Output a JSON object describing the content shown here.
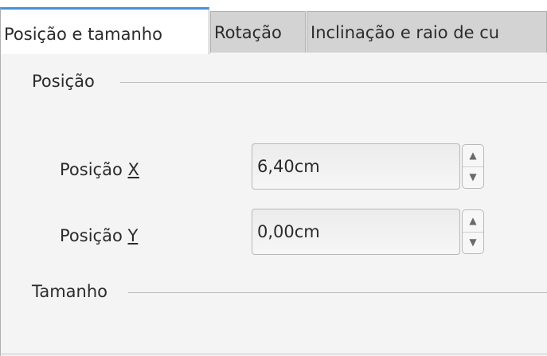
{
  "tabs": [
    {
      "label": "Posição e tamanho",
      "active": true
    },
    {
      "label": "Rotação",
      "active": false
    },
    {
      "label": "Inclinação e raio de cu",
      "active": false
    }
  ],
  "position_section": {
    "title": "Posição",
    "x_label_prefix": "Posição ",
    "x_label_mnemonic": "X",
    "x_value": "6,40cm",
    "y_label_prefix": "Posição ",
    "y_label_mnemonic": "Y",
    "y_value": "0,00cm"
  },
  "size_section": {
    "title": "Tamanho"
  },
  "icons": {
    "spin_up": "chevron-up-icon",
    "spin_down": "chevron-down-icon"
  },
  "colors": {
    "active_tab_accent": "#4a90d9",
    "panel_background": "#f4f4f4",
    "inactive_tab": "#d3d3d3"
  }
}
